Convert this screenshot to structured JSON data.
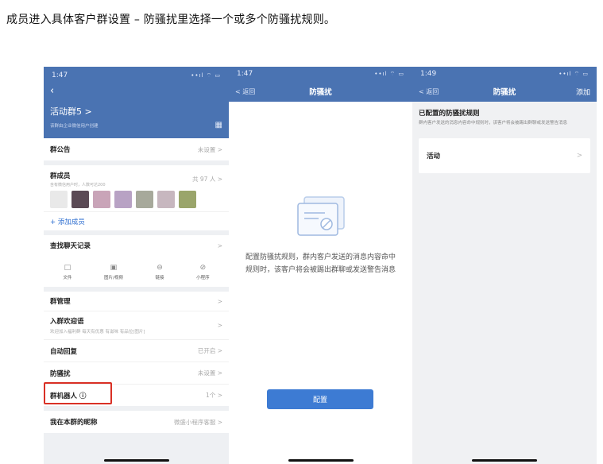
{
  "caption": "成员进入具体客户群设置 – 防骚扰里选择一个或多个防骚扰规则。",
  "colors": {
    "nav_blue": "#4a73b2",
    "button_blue": "#3d7bd3",
    "highlight_red": "#d93025"
  },
  "phone1": {
    "time": "1:47",
    "signal": "••ıl ⌔ ▭",
    "back_icon": "chevron-left-icon",
    "group_name": "活动群5 >",
    "group_sub": "该群由企业微信用户创建",
    "qr_icon": "qr-code-icon",
    "announcement": {
      "label": "群公告",
      "value": "未设置 >"
    },
    "members": {
      "label": "群成员",
      "sub": "含有微信用户时，人数可达200",
      "value": "共 97 人 >"
    },
    "add_member": "+ 添加成员",
    "find_chat": {
      "label": "查找聊天记录",
      "value": ">"
    },
    "tools": [
      {
        "icon": "folder-icon",
        "label": "文件"
      },
      {
        "icon": "image-icon",
        "label": "图片/视频"
      },
      {
        "icon": "link-icon",
        "label": "链接"
      },
      {
        "icon": "mini-program-icon",
        "label": "小程序"
      }
    ],
    "manage": {
      "label": "群管理",
      "value": ">"
    },
    "welcome": {
      "label": "入群欢迎语",
      "sub": "欢迎加入福利群 每天有优惠 有滋味 有品位[图片]",
      "value": ">"
    },
    "auto_reply": {
      "label": "自动回复",
      "value": "已开启 >"
    },
    "anti_harass": {
      "label": "防骚扰",
      "value": "未设置 >"
    },
    "robot": {
      "label": "群机器人 ⓘ",
      "value": "1个 >"
    },
    "nickname": {
      "label": "我在本群的昵称",
      "value": "微盛小程序客服 >"
    }
  },
  "phone2": {
    "time": "1:47",
    "signal": "••ıl ⌔ ▭",
    "back": "< 返回",
    "title": "防骚扰",
    "empty_text": "配置防骚扰规则，群内客户发送的消息内容命中规则时，该客户将会被踢出群聊或发送警告消息",
    "config_button": "配置"
  },
  "phone3": {
    "time": "1:49",
    "signal": "••ıl ⌔ ▭",
    "back": "< 返回",
    "title": "防骚扰",
    "add": "添加",
    "configured_title": "已配置的防骚扰规则",
    "configured_desc": "群内客户发送的消息内容命中规则时，该客户将会被踢出群聊或发送警告消息",
    "rules": [
      {
        "label": "活动",
        "chevron": ">"
      }
    ]
  }
}
